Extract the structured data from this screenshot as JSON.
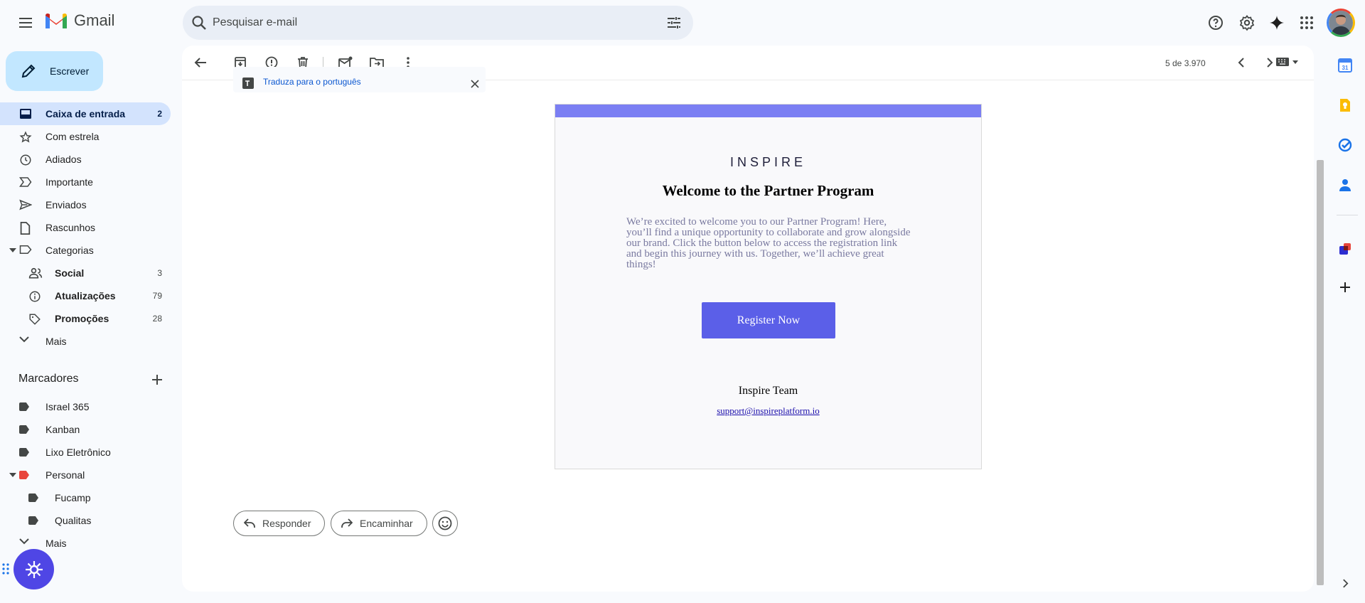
{
  "app": {
    "name": "Gmail"
  },
  "search": {
    "placeholder": "Pesquisar e-mail"
  },
  "compose": {
    "label": "Escrever"
  },
  "nav": [
    {
      "label": "Caixa de entrada",
      "count": "2"
    },
    {
      "label": "Com estrela"
    },
    {
      "label": "Adiados"
    },
    {
      "label": "Importante"
    },
    {
      "label": "Enviados"
    },
    {
      "label": "Rascunhos"
    },
    {
      "label": "Categorias"
    },
    {
      "label": "Social",
      "count": "3"
    },
    {
      "label": "Atualizações",
      "count": "79"
    },
    {
      "label": "Promoções",
      "count": "28"
    },
    {
      "label": "Mais"
    }
  ],
  "labels_section": {
    "title": "Marcadores",
    "items": [
      {
        "label": "Israel 365"
      },
      {
        "label": "Kanban"
      },
      {
        "label": "Lixo Eletrônico"
      },
      {
        "label": "Personal",
        "color": "#e8453c"
      },
      {
        "label": "Fucamp"
      },
      {
        "label": "Qualitas"
      },
      {
        "label": "Mais"
      }
    ]
  },
  "toolbar": {
    "pagination": "5 de 3.970"
  },
  "translate": {
    "text": "Traduza para o português"
  },
  "email": {
    "brand": "INSPIRE",
    "heading": "Welcome to the Partner Program",
    "body": "We’re excited to welcome you to our Partner Program! Here, you’ll find a unique opportunity to collaborate and grow alongside our brand. Click the button below to access the registration link and begin this journey with us. Together, we’ll achieve great things!",
    "cta_label": "Register Now",
    "signature": "Inspire Team",
    "support_email": "support@inspireplatform.io",
    "accent_color": "#7b7ff3",
    "button_color": "#5b5fe8"
  },
  "actions": {
    "reply": "Responder",
    "forward": "Encaminhar"
  },
  "icons": [
    "menu-icon",
    "gmail-logo",
    "search-icon",
    "tune-icon",
    "help-icon",
    "settings-icon",
    "gemini-icon",
    "apps-icon",
    "avatar",
    "back-icon",
    "archive-icon",
    "report-spam-icon",
    "delete-icon",
    "mark-unread-icon",
    "move-to-icon",
    "more-vert-icon",
    "chevron-left-icon",
    "chevron-right-icon",
    "keyboard-icon",
    "calendar-icon",
    "keep-icon",
    "tasks-icon",
    "contacts-icon",
    "add-icon",
    "reply-icon",
    "forward-icon",
    "emoji-icon"
  ]
}
